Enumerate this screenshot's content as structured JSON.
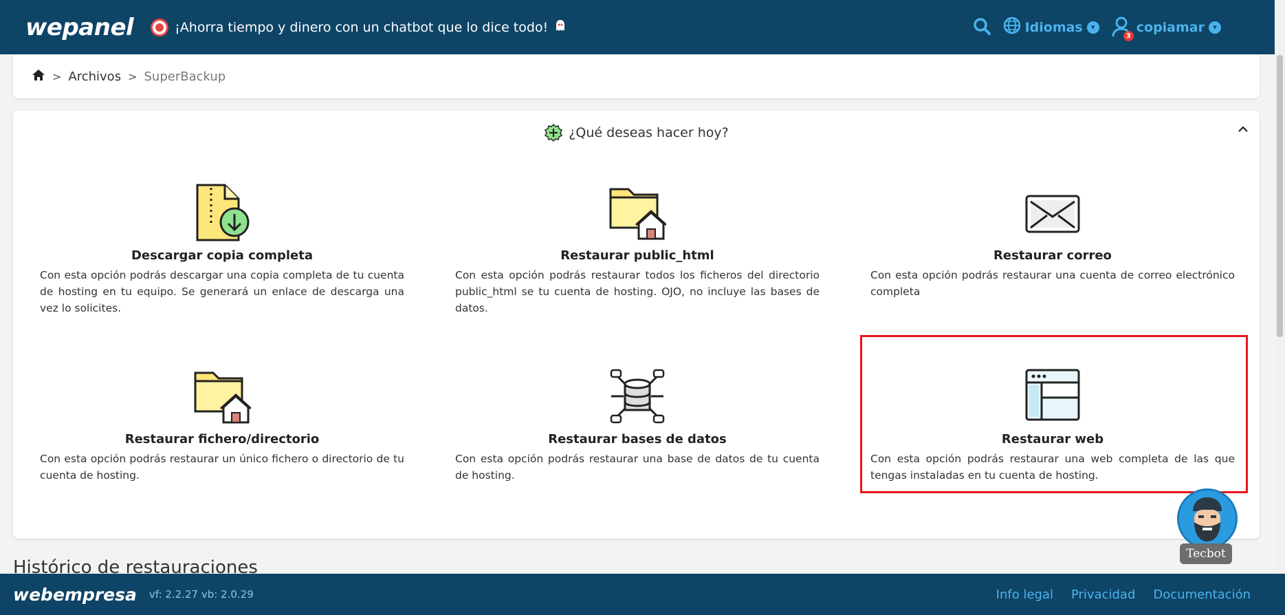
{
  "header": {
    "logo": "wepanel",
    "promo_text": "¡Ahorra tiempo y dinero con un chatbot que lo dice todo!",
    "languages_label": "Idiomas",
    "user_name": "copiamar",
    "notification_count": "3"
  },
  "breadcrumb": {
    "items": [
      "Archivos",
      "SuperBackup"
    ]
  },
  "panel": {
    "title": "¿Qué deseas hacer hoy?",
    "options": [
      {
        "title": "Descargar copia completa",
        "description": "Con esta opción podrás descargar una copia completa de tu cuenta de hosting en tu equipo. Se generará un enlace de descarga una vez lo solicites."
      },
      {
        "title": "Restaurar public_html",
        "description": "Con esta opción podrás restaurar todos los ficheros del directorio public_html se tu cuenta de hosting. OJO, no incluye las bases de datos."
      },
      {
        "title": "Restaurar correo",
        "description": "Con esta opción podrás restaurar una cuenta de correo electrónico completa"
      },
      {
        "title": "Restaurar fichero/directorio",
        "description": "Con esta opción podrás restaurar un único fichero o directorio de tu cuenta de hosting."
      },
      {
        "title": "Restaurar bases de datos",
        "description": "Con esta opción podrás restaurar una base de datos de tu cuenta de hosting."
      },
      {
        "title": "Restaurar web",
        "description": "Con esta opción podrás restaurar una web completa de las que tengas instaladas en tu cuenta de hosting."
      }
    ]
  },
  "history_title": "Histórico de restauraciones",
  "chatbot": {
    "label": "Tecbot"
  },
  "footer": {
    "logo": "webempresa",
    "version": "vf: 2.2.27 vb: 2.0.29",
    "links": [
      "Info legal",
      "Privacidad",
      "Documentación"
    ]
  },
  "colors": {
    "header_bg": "#0e4466",
    "accent": "#4ab3ee",
    "highlight": "#e8141b"
  }
}
